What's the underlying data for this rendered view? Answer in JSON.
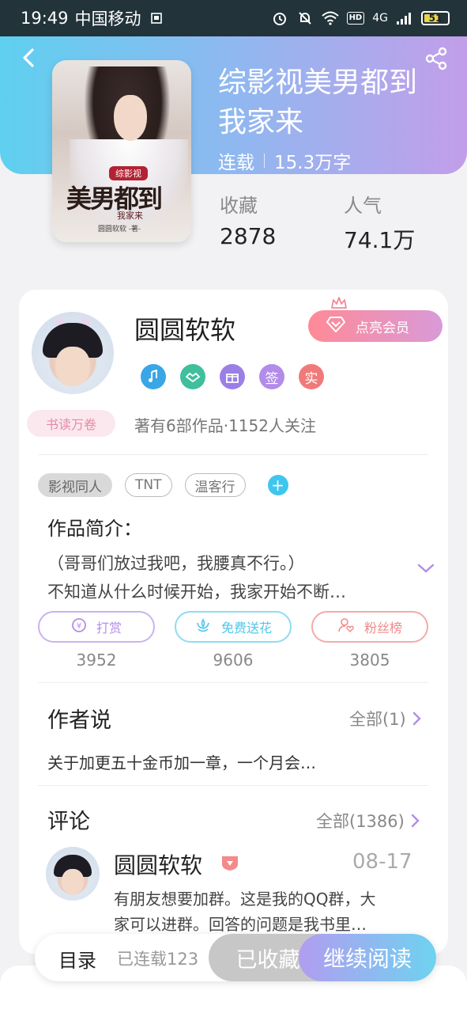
{
  "status_bar": {
    "time": "19:49",
    "carrier": "中国移动",
    "network": "4G",
    "battery": "51"
  },
  "book": {
    "title": "综影视美男都到我家来",
    "status": "连载",
    "word_count": "15.3万字",
    "stats": [
      {
        "label": "收藏",
        "value": "2878"
      },
      {
        "label": "人气",
        "value": "74.1万"
      }
    ],
    "cover": {
      "tag": "综影视",
      "title_art": "美男都到",
      "subtitle_art": "我家来",
      "author_art": "圆圆软软 -著-"
    }
  },
  "author": {
    "name": "圆圆软软",
    "vip_button": "点亮会员",
    "badges": [
      "签",
      "实"
    ],
    "read_tag": "书读万卷",
    "stats_line": "著有6部作品·1152人关注"
  },
  "tags": [
    "影视同人",
    "TNT",
    "温客行"
  ],
  "intro": {
    "title": "作品简介：",
    "line1": "（哥哥们放过我吧，我腰真不行。）",
    "line2": "不知道从什么时候开始，我家开始不断…"
  },
  "actions": [
    {
      "label": "打赏",
      "count": "3952",
      "color": "#b48ee8"
    },
    {
      "label": "免费送花",
      "count": "9606",
      "color": "#4fc6ea"
    },
    {
      "label": "粉丝榜",
      "count": "3805",
      "color": "#f08a8a"
    }
  ],
  "author_says": {
    "title": "作者说",
    "link": "全部(1)",
    "text": "关于加更五十金币加一章，一个月会…"
  },
  "comments": {
    "title": "评论",
    "link": "全部(1386)",
    "item": {
      "name": "圆圆软软",
      "date": "08-17",
      "line1": "有朋友想要加群。这是我的QQ群，大",
      "line2": "家可以进群。回答的问题是我书里…"
    }
  },
  "bottom_bar": {
    "catalog": "目录",
    "serial": "已连载123",
    "collected": "已收藏",
    "continue": "继续阅读"
  }
}
